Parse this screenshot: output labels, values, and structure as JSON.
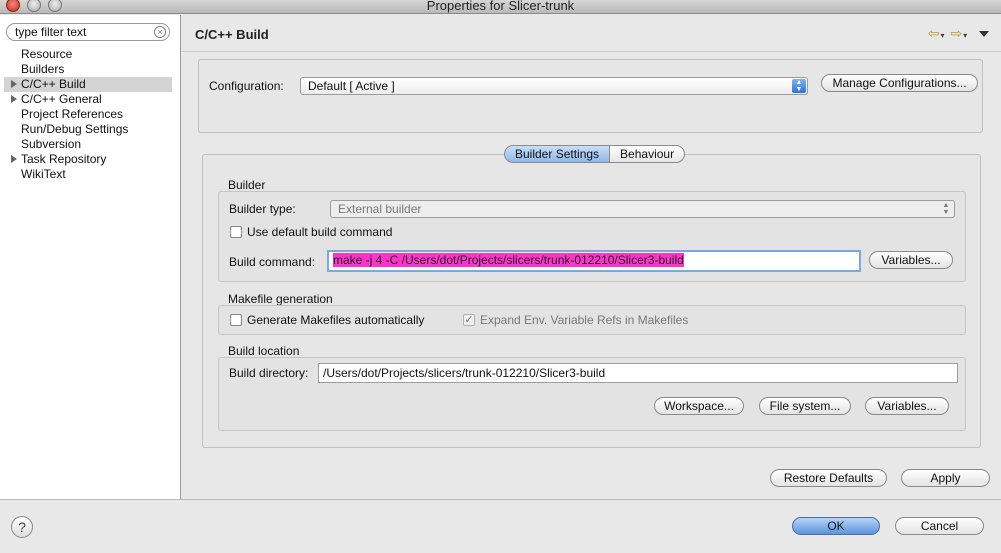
{
  "window": {
    "title": "Properties for Slicer-trunk"
  },
  "filter": {
    "placeholder": "type filter text"
  },
  "tree": {
    "items": [
      {
        "label": "Resource"
      },
      {
        "label": "Builders"
      },
      {
        "label": "C/C++ Build"
      },
      {
        "label": "C/C++ General"
      },
      {
        "label": "Project References"
      },
      {
        "label": "Run/Debug Settings"
      },
      {
        "label": "Subversion"
      },
      {
        "label": "Task Repository"
      },
      {
        "label": "WikiText"
      }
    ]
  },
  "page": {
    "title": "C/C++ Build",
    "nav_back": "⇦",
    "nav_forward": "⇨",
    "dropdown_mark": "▾"
  },
  "configuration": {
    "label": "Configuration:",
    "value": "Default  [ Active ]",
    "manage_label": "Manage Configurations..."
  },
  "tabs": {
    "builder_settings": "Builder Settings",
    "behaviour": "Behaviour"
  },
  "builder": {
    "group_label": "Builder",
    "type_label": "Builder type:",
    "type_value": "External builder",
    "use_default_label": "Use default build command",
    "command_label": "Build command:",
    "command_value": "make -j 4 -C  /Users/dot/Projects/slicers/trunk-012210/Slicer3-build",
    "variables_label": "Variables..."
  },
  "makefile": {
    "group_label": "Makefile generation",
    "generate_label": "Generate Makefiles automatically",
    "expand_label": "Expand Env. Variable Refs in Makefiles"
  },
  "location": {
    "group_label": "Build location",
    "directory_label": "Build directory:",
    "directory_value": "/Users/dot/Projects/slicers/trunk-012210/Slicer3-build",
    "workspace_label": "Workspace...",
    "filesystem_label": "File system...",
    "variables_label": "Variables..."
  },
  "footer": {
    "restore_defaults": "Restore Defaults",
    "apply": "Apply",
    "ok": "OK",
    "cancel": "Cancel",
    "help_glyph": "?"
  }
}
